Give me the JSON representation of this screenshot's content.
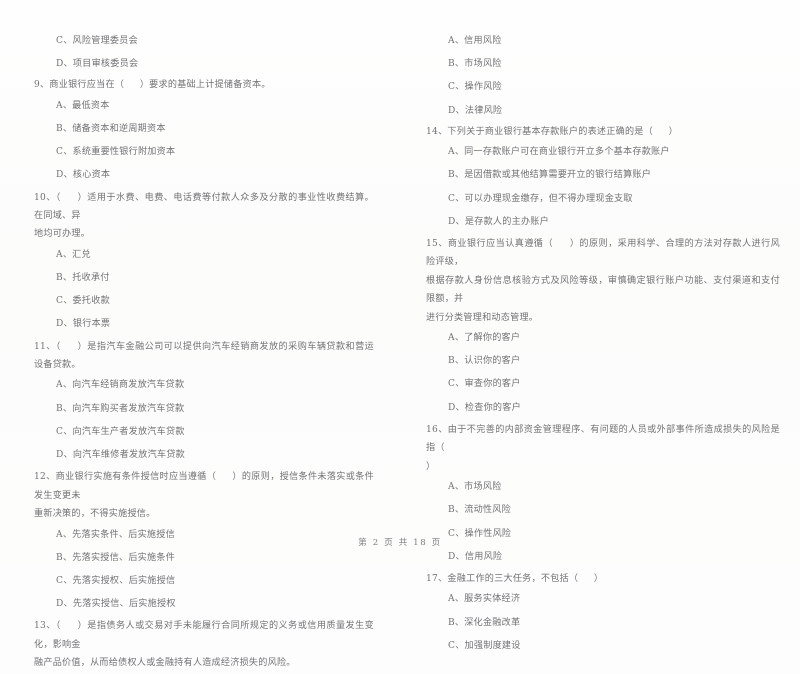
{
  "document": {
    "footer": "第 2 页 共 18 页",
    "page_number": "2",
    "total_pages": "18"
  },
  "left_column": {
    "leading_options": [
      "C、风险管理委员会",
      "D、项目审核委员会"
    ],
    "questions": [
      {
        "number": "9",
        "stem": "9、商业银行应当在（     ）要求的基础上计提储备资本。",
        "options": [
          "A、最低资本",
          "B、储备资本和逆周期资本",
          "C、系统重要性银行附加资本",
          "D、核心资本"
        ]
      },
      {
        "number": "10",
        "stem": "10、（     ）适用于水费、电费、电话费等付款人众多及分散的事业性收费结算。在同域、异\n地均可办理。",
        "options": [
          "A、汇兑",
          "B、托收承付",
          "C、委托收款",
          "D、银行本票"
        ]
      },
      {
        "number": "11",
        "stem": "11、（     ）是指汽车金融公司可以提供向汽车经销商发放的采购车辆贷款和营运设备贷款。",
        "options": [
          "A、向汽车经销商发放汽车贷款",
          "B、向汽车购买者发放汽车贷款",
          "C、向汽车生产者发放汽车贷款",
          "D、向汽车维修者发放汽车贷款"
        ]
      },
      {
        "number": "12",
        "stem": "12、商业银行实施有条件授信时应当遵循（     ）的原则，授信条件未落实或条件发生变更未\n重新决策的，不得实施授信。",
        "options": [
          "A、先落实条件、后实施授信",
          "B、先落实授信、后实施条件",
          "C、先落实授权、后实施授信",
          "D、先落实授信、后实施授权"
        ]
      },
      {
        "number": "13",
        "stem": "13、（     ）是指债务人或交易对手未能履行合同所规定的义务或信用质量发生变化，影响金\n融产品价值，从而给债权人或金融持有人造成经济损失的风险。",
        "options": []
      }
    ]
  },
  "right_column": {
    "leading_options": [
      "A、信用风险",
      "B、市场风险",
      "C、操作风险",
      "D、法律风险"
    ],
    "questions": [
      {
        "number": "14",
        "stem": "14、下列关于商业银行基本存款账户的表述正确的是（     ）",
        "options": [
          "A、同一存款账户可在商业银行开立多个基本存款账户",
          "B、是因借款或其他结算需要开立的银行结算账户",
          "C、可以办理现金缴存，但不得办理现金支取",
          "D、是存款人的主办账户"
        ]
      },
      {
        "number": "15",
        "stem": "15、商业银行应当认真遵循（     ）的原则，采用科学、合理的方法对存款人进行风险评级，\n根据存款人身份信息核验方式及风险等级，审慎确定银行账户功能、支付渠道和支付限额，并\n进行分类管理和动态管理。",
        "options": [
          "A、了解你的客户",
          "B、认识你的客户",
          "C、审查你的客户",
          "D、检查你的客户"
        ]
      },
      {
        "number": "16",
        "stem": "16、由于不完善的内部资金管理程序、有问题的人员或外部事件所造成损失的风险是指（\n）",
        "options": [
          "A、市场风险",
          "B、流动性风险",
          "C、操作性风险",
          "D、信用风险"
        ]
      },
      {
        "number": "17",
        "stem": "17、金融工作的三大任务，不包括（     ）",
        "options": [
          "A、服务实体经济",
          "B、深化金融改革",
          "C、加强制度建设"
        ]
      }
    ]
  }
}
